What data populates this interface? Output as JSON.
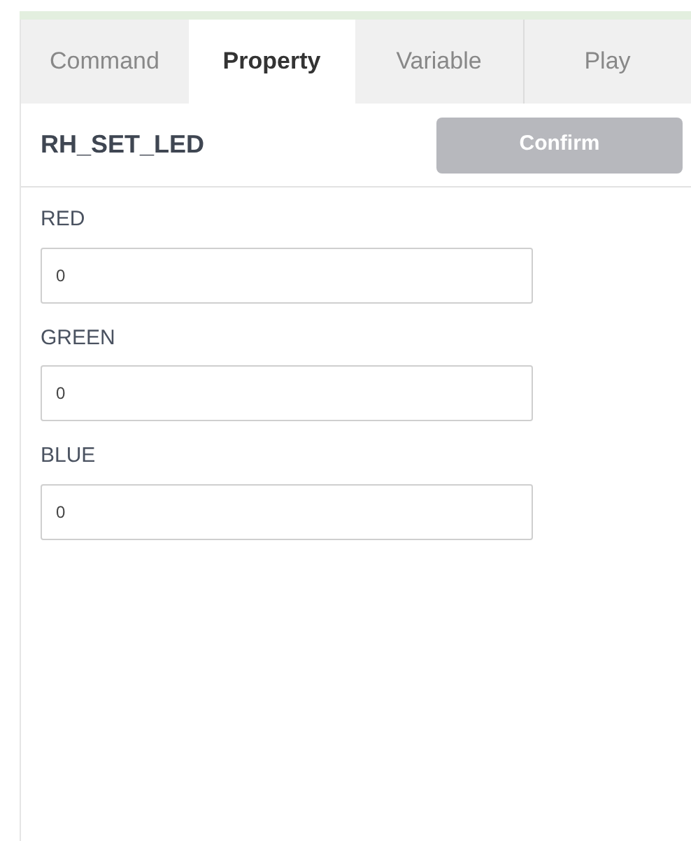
{
  "tabs": [
    {
      "label": "Command",
      "selected": false
    },
    {
      "label": "Property",
      "selected": true
    },
    {
      "label": "Variable",
      "selected": false
    },
    {
      "label": "Play",
      "selected": false
    }
  ],
  "header": {
    "title": "RH_SET_LED",
    "confirm": {
      "label": "Confirm",
      "disabled": true
    }
  },
  "fields": [
    {
      "label": "RED",
      "value": "0"
    },
    {
      "label": "GREEN",
      "value": "0"
    },
    {
      "label": "BLUE",
      "value": "0"
    }
  ]
}
